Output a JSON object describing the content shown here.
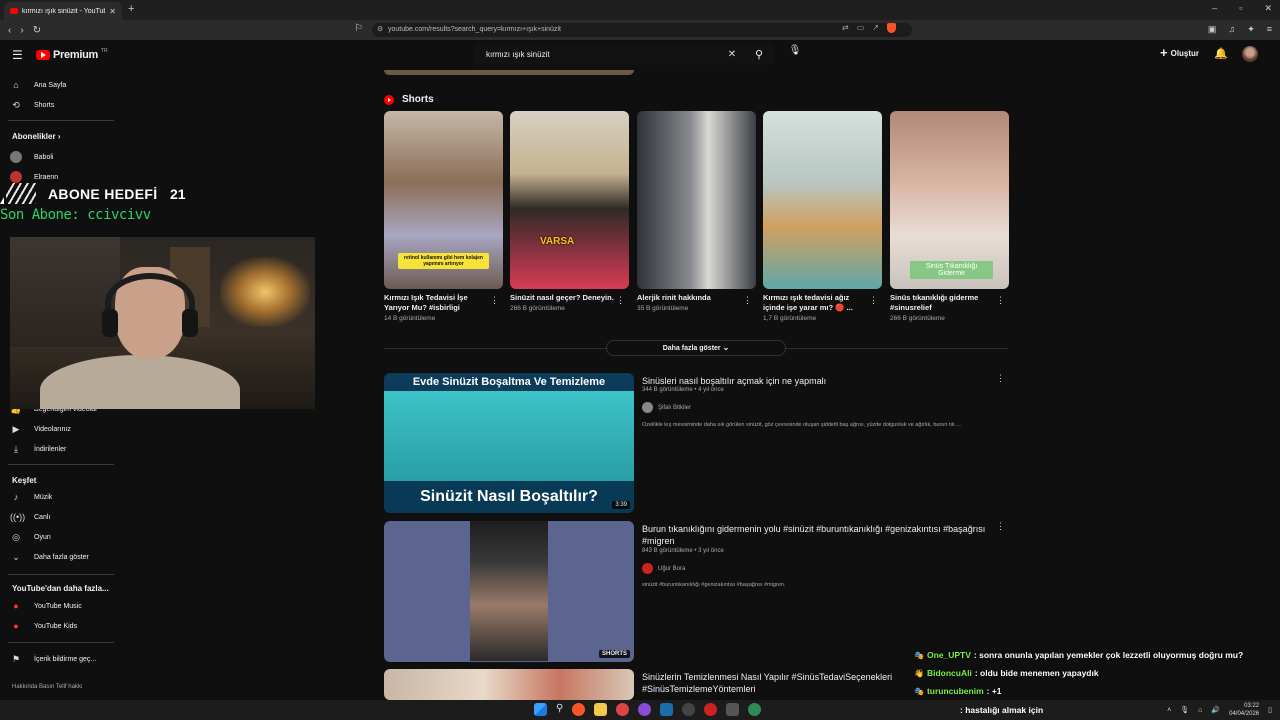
{
  "browser": {
    "tab_title": "kırmızı ışık sinüzit - YouTube",
    "url": "youtube.com/results?search_query=kırmızı+ışık+sinüzit"
  },
  "header": {
    "logo_text": "Premium",
    "logo_suffix": "TR",
    "search_value": "kırmızı ışık sinüzit",
    "create_label": "Oluştur"
  },
  "sidebar": {
    "home": "Ana Sayfa",
    "shorts": "Shorts",
    "subs_heading": "Abonelikler",
    "subs_chevron": "›",
    "channels": [
      "Baboli",
      "Elraenn"
    ],
    "liked": "Beğendiğim videolar",
    "your_videos": "Videolarınız",
    "downloads": "İndirilenler",
    "explore_heading": "Keşfet",
    "explore": [
      "Müzik",
      "Canlı",
      "Oyun",
      "Daha fazla göster"
    ],
    "more_heading": "YouTube'dan daha fazla...",
    "more": [
      "YouTube Music",
      "YouTube Kids"
    ],
    "report": "İçerik bildirme geç...",
    "footer": "Hakkında   Basın   Telif hakkı"
  },
  "overlay": {
    "goal_label": "ABONE HEDEFİ",
    "goal_count": "21",
    "last_sub": "Son Abone: ccivcivv"
  },
  "shorts": {
    "heading": "Shorts",
    "items": [
      {
        "title": "Kırmızı Işık Tedavisi İşe Yarıyor Mu? #isbirligi",
        "views": "14 B görüntüleme",
        "caption": "retinol kullanımı gibi hem kolajen yapımını artırıyor"
      },
      {
        "title": "Sinüzit nasıl geçer? Deneyin.",
        "views": "266 B görüntüleme",
        "caption": "VARSA"
      },
      {
        "title": "Alerjik rinit hakkında",
        "views": "35 B görüntüleme",
        "caption": ""
      },
      {
        "title": "Kırmızı ışık tedavisi ağız içinde işe yarar mı? 🔴 ...",
        "views": "1,7 B görüntüleme",
        "caption": ""
      },
      {
        "title": "Sinüs tıkanıklığı giderme #sinusrelief",
        "views": "266 B görüntüleme",
        "caption": "Sinüs Tıkanıklığı Giderme"
      }
    ],
    "show_more": "Daha fazla göster"
  },
  "videos": [
    {
      "title": "Sinüsleri nasıl boşaltılır açmak için ne yapmalı",
      "meta": "344 B görüntüleme • 4 yıl önce",
      "channel": "Şifalı Bitkiler",
      "desc": "Özellikle kış mevsiminde daha sık görülen sinüzit, göz çevresinde oluşan şiddetli baş ağrısı, yüzde dolgunluk ve ağırlık, burun tık ...",
      "thumb_top": "Evde Sinüzit Boşaltma Ve Temizleme",
      "thumb_bottom": "Sinüzit Nasıl Boşaltılır?",
      "duration": "3:39"
    },
    {
      "title": "Burun tıkanıklığını gidermenin yolu #sinüzit #buruntıkanıklığı #genizakıntısı #başağrısı #migren",
      "meta": "843 B görüntüleme • 3 yıl önce",
      "channel": "Uğur Bora",
      "desc": "sinüzit #buruntıkanıklığı #genizakıntısı #başağrısı #migren.",
      "badge": "SHORTS"
    },
    {
      "title": "Sinüzlerin Temizlenmesi Nasıl Yapılır #SinüsTedaviSeçenekleri #SinüsTemizlemeYöntemleri"
    }
  ],
  "chat": [
    {
      "user": "One_UPTV",
      "msg": ": sonra onunla yapılan yemekler çok lezzetli oluyormuş doğru mu?"
    },
    {
      "user": "BidoncuAli",
      "msg": ": oldu bide menemen yapaydık"
    },
    {
      "user": "turuncubenim",
      "msg": ": +1"
    }
  ],
  "chat_continuation": ": hastalığı almak için",
  "taskbar": {
    "time": "03:22",
    "date": "04/04/2026"
  },
  "colors": {
    "background": "#0f0f0f",
    "brand_red": "#ff0000",
    "chat_user": "#7cf04a",
    "last_sub": "#2bd36a"
  }
}
